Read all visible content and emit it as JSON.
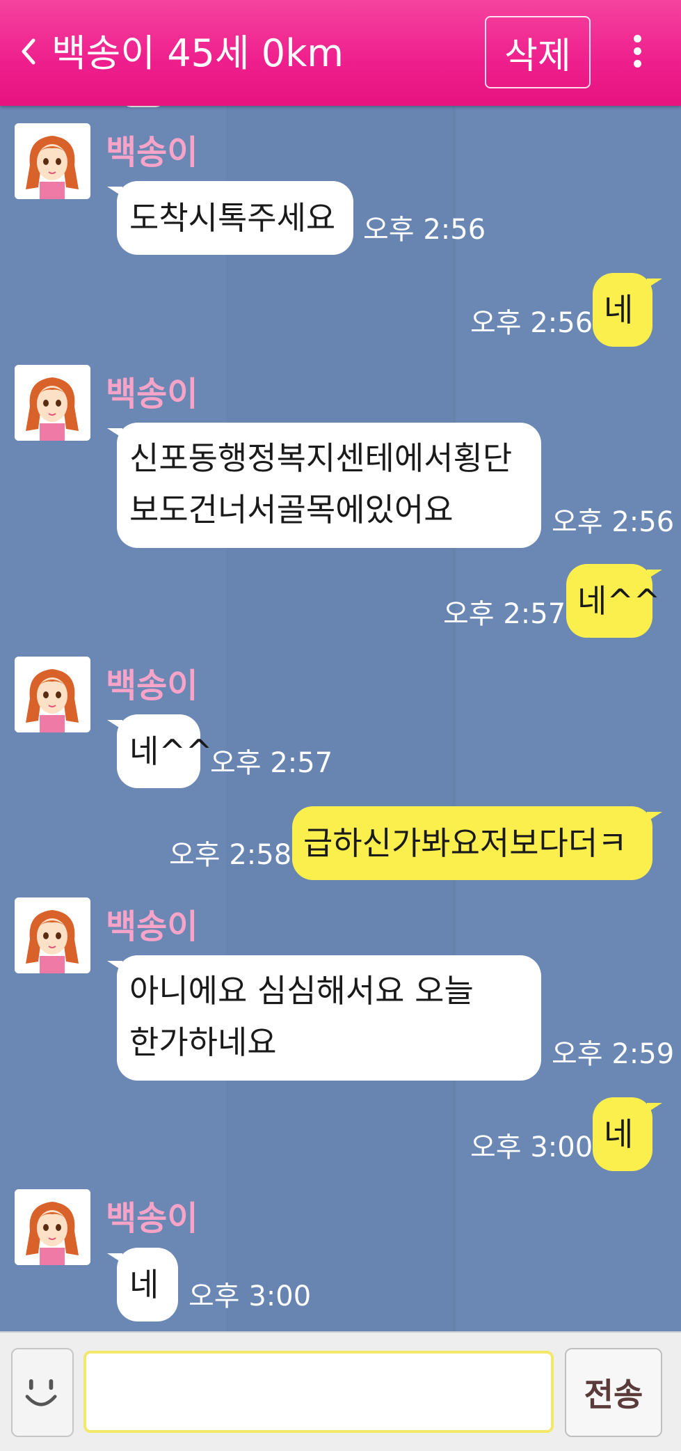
{
  "header": {
    "title": "백송이 45세 0km",
    "delete_label": "삭제"
  },
  "messages": [
    {
      "side": "in",
      "sender": "백송이",
      "text": "도착시톡주세요",
      "time": "오후 2:56"
    },
    {
      "side": "out",
      "text": "네",
      "time": "오후 2:56"
    },
    {
      "side": "in",
      "sender": "백송이",
      "lines": [
        "신포동행정복지센테에서횡단",
        "보도건너서골목에있어요"
      ],
      "time": "오후 2:56"
    },
    {
      "side": "out",
      "text": "네^^",
      "time": "오후 2:57"
    },
    {
      "side": "in",
      "sender": "백송이",
      "text": "네^^",
      "time": "오후 2:57"
    },
    {
      "side": "out",
      "text": "급하신가봐요저보다더ㅋ",
      "time": "오후 2:58"
    },
    {
      "side": "in",
      "sender": "백송이",
      "lines": [
        "아니에요 심심해서요 오늘",
        "한가하네요"
      ],
      "time": "오후 2:59"
    },
    {
      "side": "out",
      "text": "네",
      "time": "오후 3:00"
    },
    {
      "side": "in",
      "sender": "백송이",
      "text": "네",
      "time": "오후 3:00"
    }
  ],
  "composer": {
    "value": "",
    "send_label": "전송"
  },
  "colors": {
    "header": "#ee1e8c",
    "chat_bg": "#6b87b3",
    "outgoing_bubble": "#fbef4e",
    "incoming_bubble": "#ffffff",
    "sender_name": "#f8a3c8"
  },
  "icons": {
    "back": "chevron-left-icon",
    "more": "more-vertical-icon",
    "emoji": "smiley-icon"
  }
}
